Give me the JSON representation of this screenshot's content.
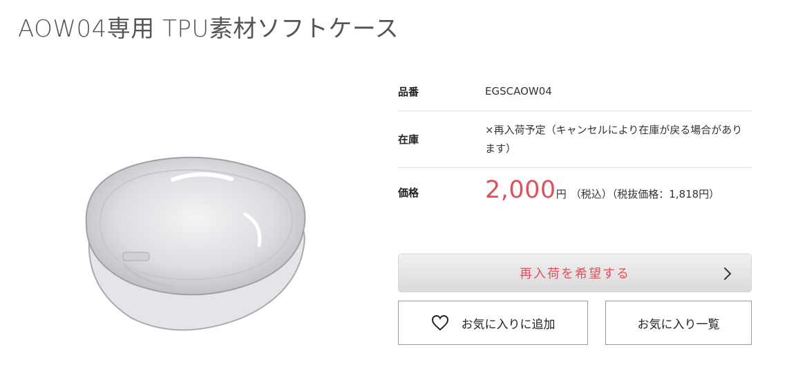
{
  "product": {
    "title": "AOW04専用 TPU素材ソフトケース"
  },
  "specs": {
    "code_label": "品番",
    "code_value": "EGSCAOW04",
    "stock_label": "在庫",
    "stock_value": "×再入荷予定（キャンセルにより在庫が戻る場合があります）",
    "price_label": "価格",
    "price_value": "2,000",
    "price_unit": "円",
    "price_note": "（税込）（税抜価格：1,818円）"
  },
  "actions": {
    "restock_label": "再入荷を希望する",
    "favorite_add_label": "お気に入りに追加",
    "favorite_list_label": "お気に入り一覧"
  },
  "icons": {
    "restock_arrow": "chevron-right-icon",
    "favorite": "heart-icon"
  },
  "colors": {
    "price": "#e0505a",
    "restock_text": "#e0505a",
    "button_border": "#9a9a9a"
  }
}
